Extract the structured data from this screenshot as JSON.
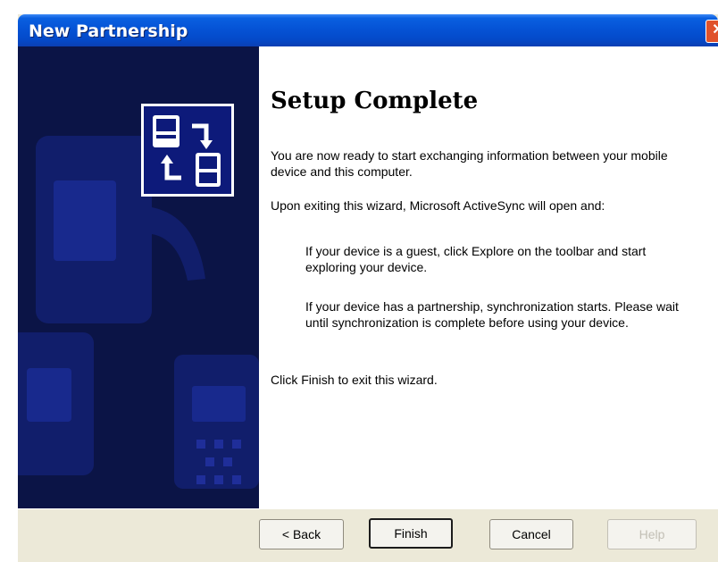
{
  "window": {
    "title": "New Partnership"
  },
  "page": {
    "heading": "Setup Complete",
    "paragraphs": {
      "ready": "You are now ready to start exchanging information between your mobile device and this computer.",
      "exiting": "Upon exiting this wizard, Microsoft ActiveSync will open and:",
      "guest": "If your device is a guest, click Explore on the toolbar and start exploring your device.",
      "partnership": "If your device has a partnership, synchronization starts. Please wait until synchronization is complete before using your device.",
      "finish": "Click Finish to exit this wizard."
    }
  },
  "buttons": {
    "back": "< Back",
    "finish": "Finish",
    "cancel": "Cancel",
    "help": "Help"
  },
  "icons": {
    "close": "close-icon",
    "sync": "device-sync-icon"
  },
  "colors": {
    "titlebar": "#0553d6",
    "panel": "#0b1446",
    "face": "#ece9d8"
  }
}
